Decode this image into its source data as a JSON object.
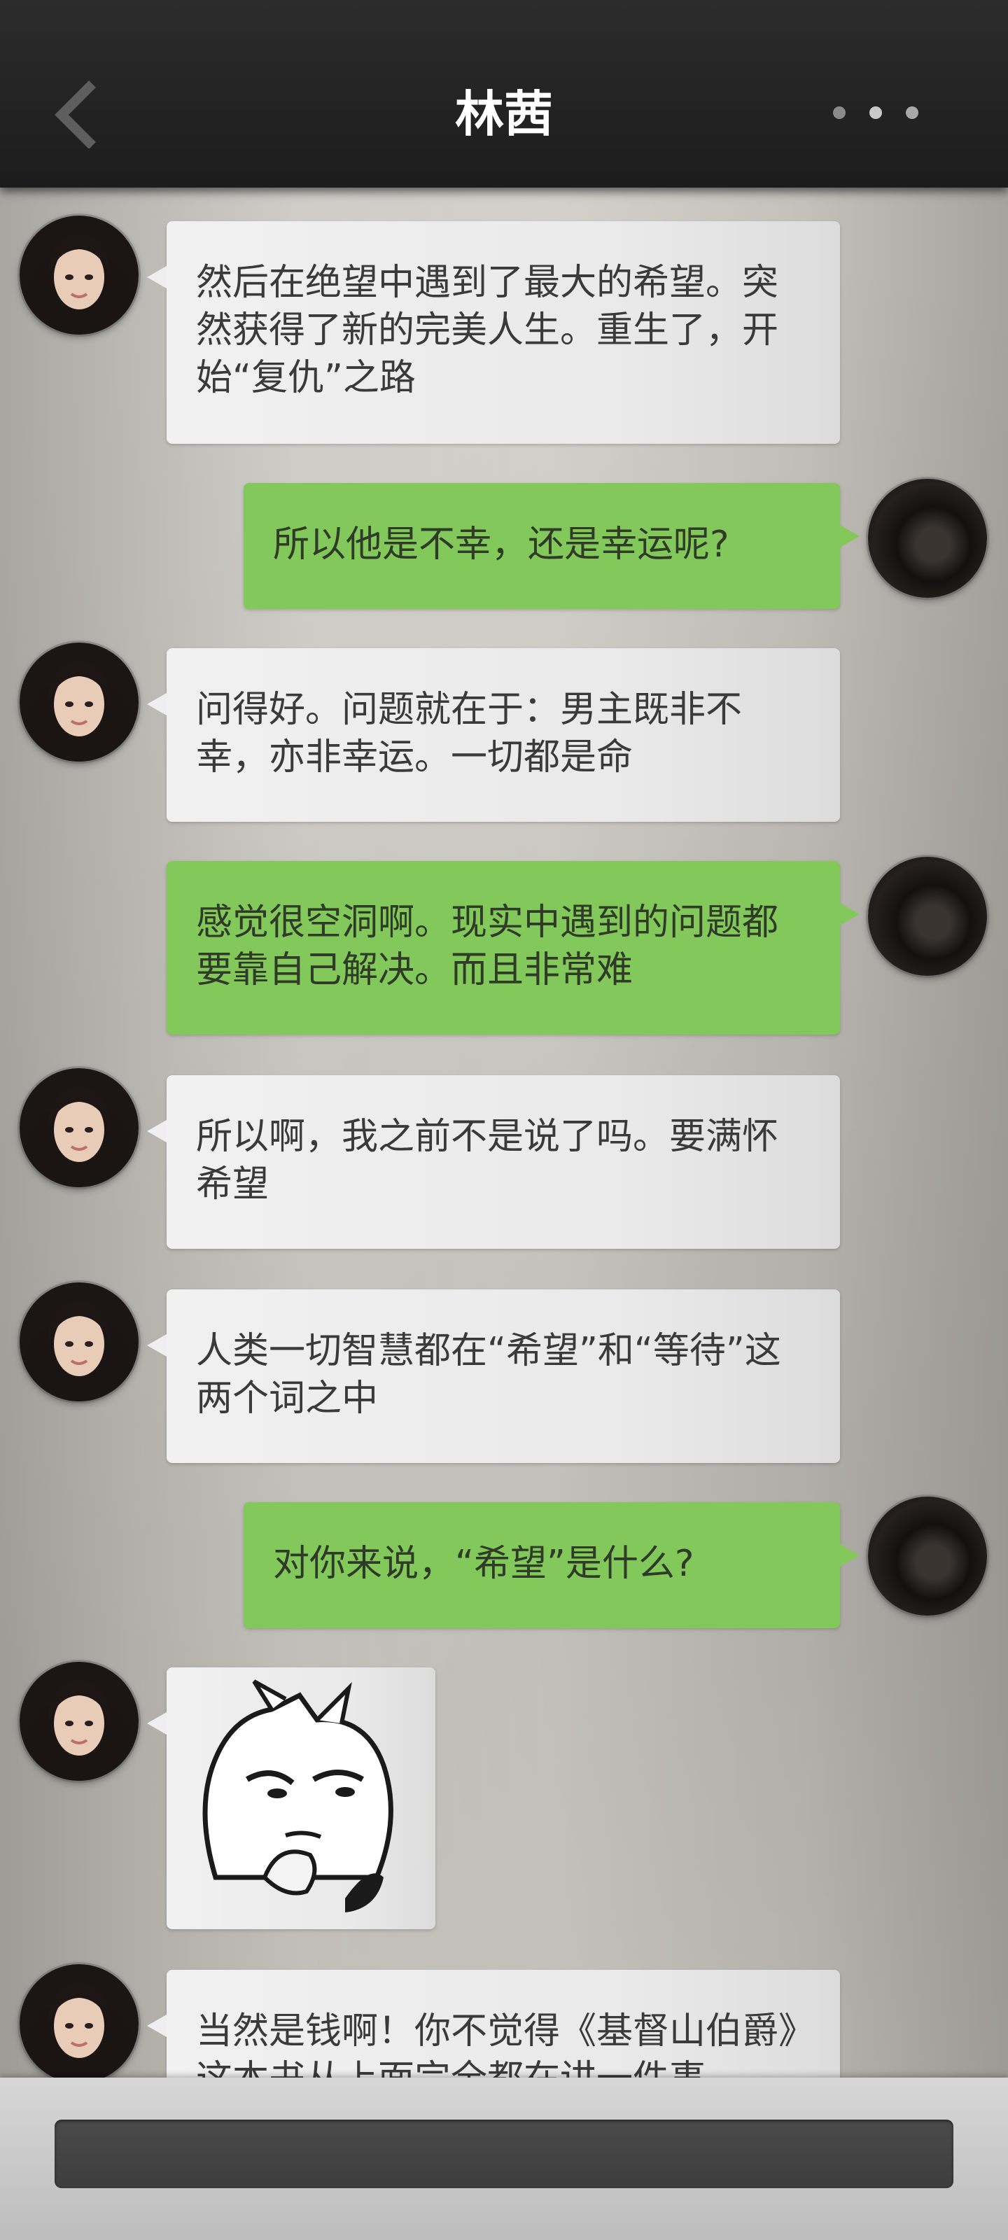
{
  "header": {
    "title": "林茜",
    "back_icon": "back-chevron-icon",
    "more_icon": "more-dots-icon"
  },
  "messages": [
    {
      "side": "left",
      "text": "然后在绝望中遇到了最大的希望。突然获得了新的完美人生。重生了，开始“复仇”之路"
    },
    {
      "side": "right",
      "text": "所以他是不幸，还是幸运呢?"
    },
    {
      "side": "left",
      "text": "问得好。问题就在于：男主既非不幸，亦非幸运。一切都是命"
    },
    {
      "side": "right",
      "text": "感觉很空洞啊。现实中遇到的问题都要靠自己解决。而且非常难"
    },
    {
      "side": "left",
      "text": "所以啊，我之前不是说了吗。要满怀希望"
    },
    {
      "side": "left",
      "text": "人类一切智慧都在“希望”和“等待”这两个词之中"
    },
    {
      "side": "right",
      "text": "对你来说，“希望”是什么?"
    },
    {
      "side": "left",
      "sticker": "smug-cartoon-sticker"
    },
    {
      "side": "left",
      "text": "当然是钱啊！你不觉得《基督山伯爵》这本书从上面完全都在讲一件事"
    }
  ],
  "composer": {
    "input_value": ""
  }
}
